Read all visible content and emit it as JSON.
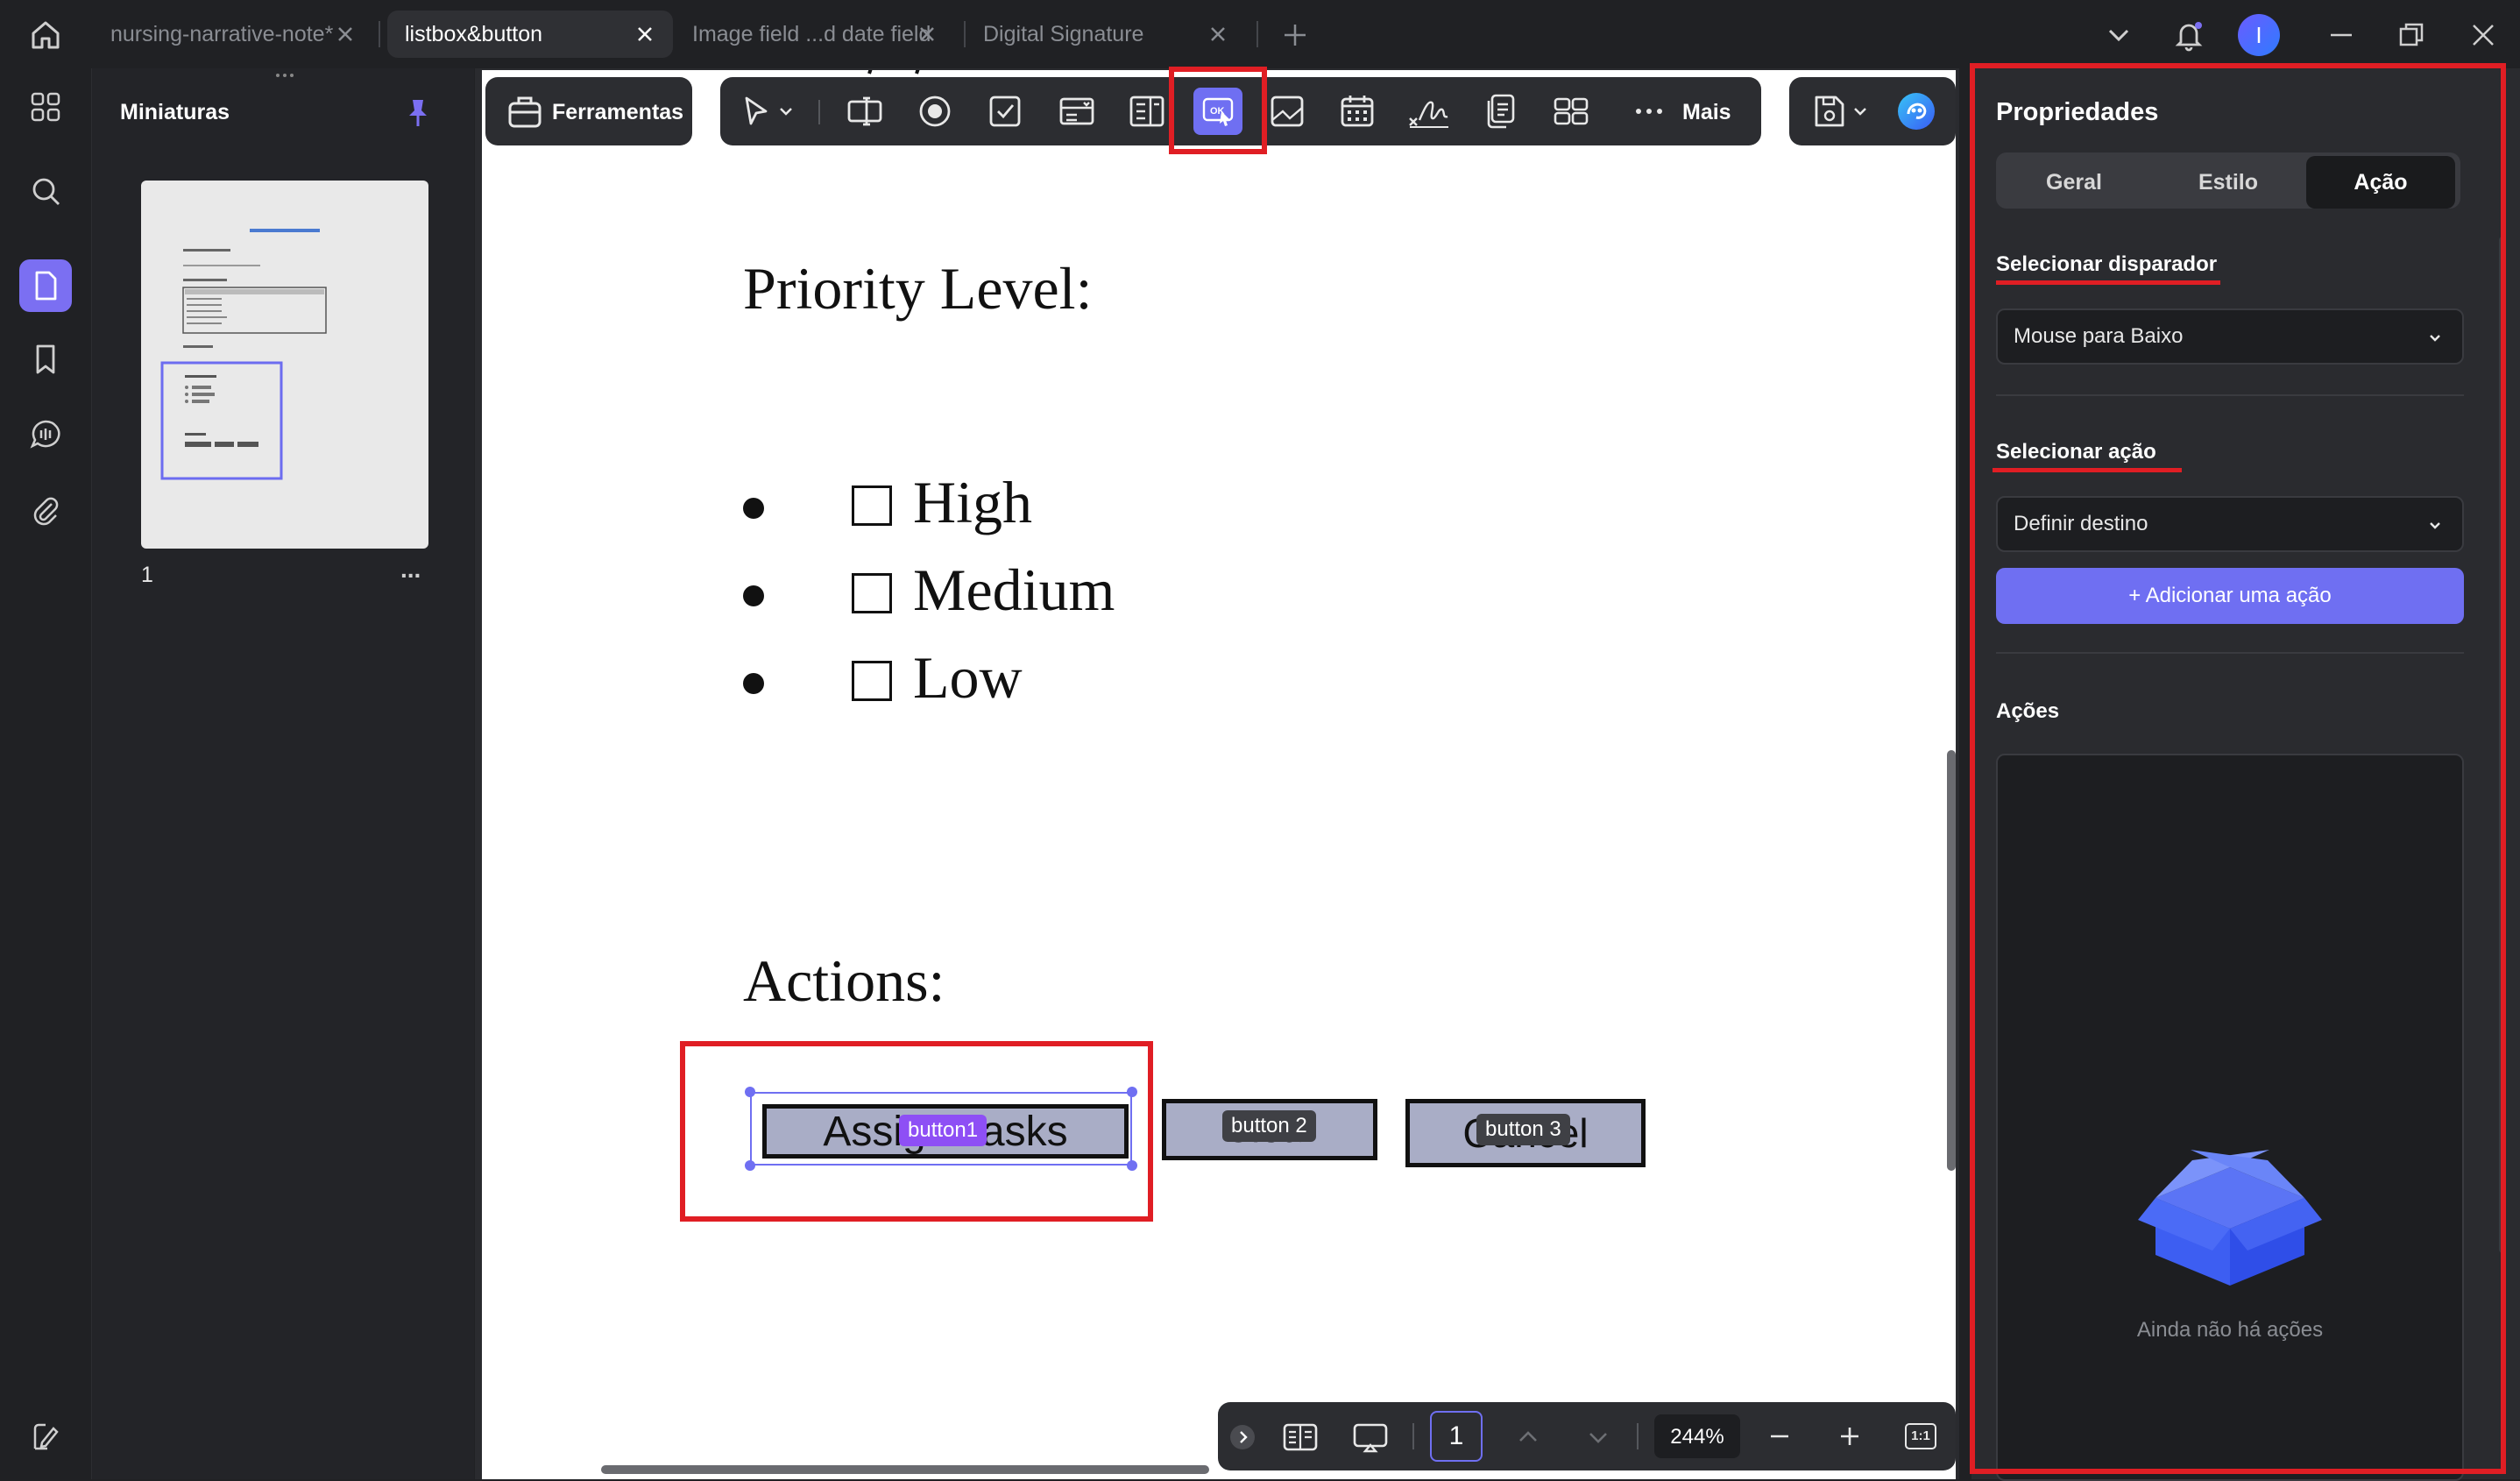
{
  "tabs": [
    {
      "label": "nursing-narrative-note*",
      "active": false
    },
    {
      "label": "listbox&button",
      "active": true
    },
    {
      "label": "Image field ...d date field",
      "active": false
    },
    {
      "label": "Digital Signature",
      "active": false
    }
  ],
  "user": {
    "avatar_letter": "I"
  },
  "thumbnails": {
    "title": "Miniaturas",
    "page_number": "1",
    "more": "..."
  },
  "toolbar": {
    "tools_label": "Ferramentas",
    "more_label": "Mais"
  },
  "document": {
    "priority_heading": "Priority Level:",
    "priority_options": [
      "High",
      "Medium",
      "Low"
    ],
    "actions_heading": "Actions:",
    "buttons": [
      {
        "face_text": "Assign Tasks",
        "field_name": "button1"
      },
      {
        "face_text": "Clear",
        "field_name": "button 2"
      },
      {
        "face_text": "Cancel",
        "field_name": "button 3"
      }
    ]
  },
  "properties": {
    "title": "Propriedades",
    "tabs": [
      "Geral",
      "Estilo",
      "Ação"
    ],
    "active_tab": "Ação",
    "trigger_label": "Selecionar disparador",
    "trigger_value": "Mouse para Baixo",
    "action_label": "Selecionar ação",
    "action_value": "Definir destino",
    "add_action_button": "+ Adicionar uma ação",
    "actions_label": "Ações",
    "empty_text": "Ainda não há ações"
  },
  "bottombar": {
    "page_input": "1",
    "zoom": "244%",
    "fit_label": "1:1"
  },
  "colors": {
    "accent": "#7b6ff2",
    "highlight": "#e01e24",
    "primary_button": "#6f6ff2"
  }
}
